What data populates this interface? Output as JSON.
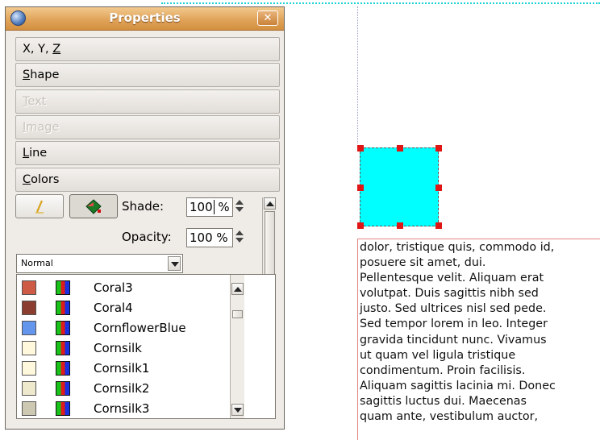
{
  "window": {
    "title": "Properties",
    "close_glyph": "✕"
  },
  "sections": [
    {
      "label_pre": "X, Y, ",
      "mnemonic": "Z",
      "label_post": "",
      "enabled": true
    },
    {
      "label_pre": "",
      "mnemonic": "S",
      "label_post": "hape",
      "enabled": true
    },
    {
      "label_pre": "",
      "mnemonic": "T",
      "label_post": "ext",
      "enabled": false
    },
    {
      "label_pre": "",
      "mnemonic": "I",
      "label_post": "mage",
      "enabled": false
    },
    {
      "label_pre": "",
      "mnemonic": "L",
      "label_post": "ine",
      "enabled": true
    },
    {
      "label_pre": "",
      "mnemonic": "C",
      "label_post": "olors",
      "enabled": true
    }
  ],
  "colors_panel": {
    "buttons": {
      "line_color": "pencil-icon",
      "fill_color": "paint-bucket-icon"
    },
    "shade_label": "Shade:",
    "shade_value": "100",
    "shade_unit": "%",
    "opacity_label": "Opacity:",
    "opacity_value": "100 %",
    "blend_mode": "Normal",
    "color_list": [
      {
        "name": "Coral3",
        "hex": "#cd5b45"
      },
      {
        "name": "Coral4",
        "hex": "#8b3e2f"
      },
      {
        "name": "CornflowerBlue",
        "hex": "#6495ed"
      },
      {
        "name": "Cornsilk",
        "hex": "#fff8dc"
      },
      {
        "name": "Cornsilk1",
        "hex": "#fff8dc"
      },
      {
        "name": "Cornsilk2",
        "hex": "#eee8cd"
      },
      {
        "name": "Cornsilk3",
        "hex": "#cdc8b1"
      }
    ]
  },
  "canvas": {
    "shape_fill": "#00ffff",
    "text": "dolor, tristique quis, commodo id,\nposuere sit amet, dui.\nPellentesque velit. Aliquam erat\nvolutpat. Duis sagittis nibh sed\njusto. Sed ultrices nisl sed pede.\nSed tempor lorem in leo. Integer\ngravida tincidunt nunc. Vivamus\nut quam vel ligula tristique\ncondimentum. Proin facilisis.\nAliquam sagittis lacinia mi. Donec\nsagittis luctus dui. Maecenas\nquam ante, vestibulum auctor,"
  }
}
